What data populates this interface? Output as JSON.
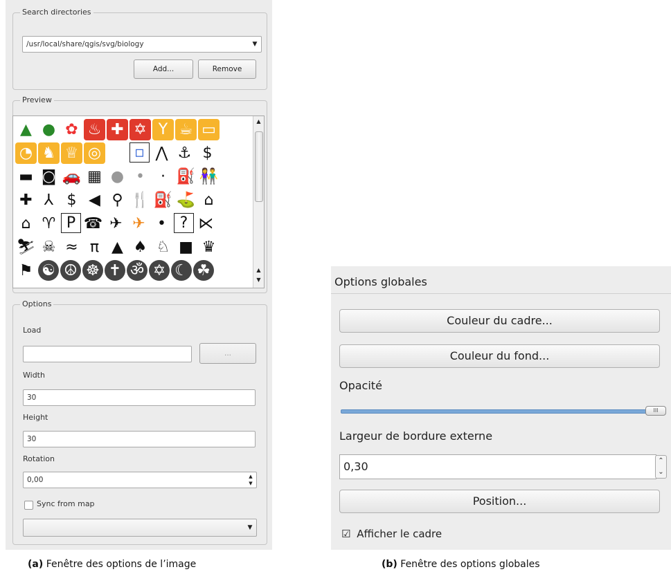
{
  "panel_a": {
    "search_group_title": "Search directories",
    "directory_value": "/usr/local/share/qgis/svg/biology",
    "add_label": "Add...",
    "remove_label": "Remove",
    "preview_group_title": "Preview",
    "preview_icons": [
      [
        {
          "g": "▲",
          "c": "#2a8a2a"
        },
        {
          "g": "●",
          "c": "#2a8a2a"
        },
        {
          "g": "✿",
          "c": "#e33"
        },
        {
          "g": "♨",
          "s": "red"
        },
        {
          "g": "✚",
          "s": "red"
        },
        {
          "g": "✡",
          "s": "red"
        },
        {
          "g": "Y",
          "s": "orange"
        },
        {
          "g": "☕",
          "s": "orange"
        },
        {
          "g": "▭",
          "s": "orange"
        }
      ],
      [
        {
          "g": "◔",
          "s": "orange"
        },
        {
          "g": "♞",
          "s": "orange"
        },
        {
          "g": "♕",
          "s": "orange"
        },
        {
          "g": "◎",
          "s": "orange"
        },
        {
          "g": ""
        },
        {
          "g": "▫",
          "c": "#3a6ad8",
          "b": "boxed"
        },
        {
          "g": "⋀"
        },
        {
          "g": "⚓"
        },
        {
          "g": "$"
        }
      ],
      [
        {
          "g": "▬"
        },
        {
          "g": "◙"
        },
        {
          "g": "🚗"
        },
        {
          "g": "▦"
        },
        {
          "g": "●",
          "c": "#999"
        },
        {
          "g": "•",
          "c": "#999"
        },
        {
          "g": "·"
        },
        {
          "g": "⛽"
        },
        {
          "g": "👫"
        }
      ],
      [
        {
          "g": "✚"
        },
        {
          "g": "⅄"
        },
        {
          "g": "$"
        },
        {
          "g": "◀"
        },
        {
          "g": "⚲"
        },
        {
          "g": "🍴"
        },
        {
          "g": "⛽"
        },
        {
          "g": "⛳"
        },
        {
          "g": "⌂"
        }
      ],
      [
        {
          "g": "⌂"
        },
        {
          "g": "♈"
        },
        {
          "g": "P",
          "b": "boxed"
        },
        {
          "g": "☎"
        },
        {
          "g": "✈"
        },
        {
          "g": "✈",
          "c": "#f08a20"
        },
        {
          "g": "•"
        },
        {
          "g": "?",
          "b": "boxed"
        },
        {
          "g": "⋉"
        }
      ],
      [
        {
          "g": "⛷"
        },
        {
          "g": "☠"
        },
        {
          "g": "≈"
        },
        {
          "g": "π"
        },
        {
          "g": "▲"
        },
        {
          "g": "♠"
        },
        {
          "g": "♘"
        },
        {
          "g": "■"
        },
        {
          "g": "♛"
        }
      ],
      [
        {
          "g": "⚑"
        },
        {
          "g": "☯",
          "s": "dark"
        },
        {
          "g": "☮",
          "s": "dark"
        },
        {
          "g": "☸",
          "s": "dark"
        },
        {
          "g": "✝",
          "s": "dark"
        },
        {
          "g": "ॐ",
          "s": "dark"
        },
        {
          "g": "✡",
          "s": "dark"
        },
        {
          "g": "☾",
          "s": "dark"
        },
        {
          "g": "☘",
          "s": "dark"
        }
      ]
    ],
    "options_group_title": "Options",
    "load_label": "Load",
    "load_value": "",
    "browse_label": "...",
    "width_label": "Width",
    "width_value": "30",
    "height_label": "Height",
    "height_value": "30",
    "rotation_label": "Rotation",
    "rotation_value": "0,00",
    "sync_label": "Sync from map",
    "sync_checked": false,
    "bottom_combo_value": ""
  },
  "panel_b": {
    "title": "Options globales",
    "frame_color_label": "Couleur du cadre...",
    "background_color_label": "Couleur du fond...",
    "opacity_label": "Opacité",
    "opacity_value": 1.0,
    "outer_border_label": "Largeur de bordure externe",
    "outer_border_value": "0,30",
    "position_label": "Position...",
    "show_frame_label": "Afficher le cadre",
    "show_frame_checked": true
  },
  "captions": {
    "a_prefix": "(a)",
    "a_text": "Fenêtre des options de l’image",
    "b_prefix": "(b)",
    "b_text": "Fenêtre des options globales"
  },
  "colors": {
    "panel_bg": "#ececec",
    "slider_blue": "#7aa8d8",
    "icon_red": "#e03a2c",
    "icon_orange": "#f7b42c"
  }
}
